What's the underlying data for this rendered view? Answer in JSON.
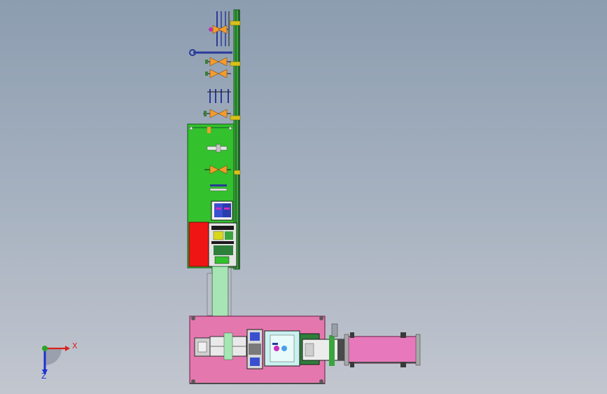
{
  "viewport": {
    "background_top": "#8c9db0",
    "background_bottom": "#c2c6cf"
  },
  "triad": {
    "x_label": "X",
    "y_label": "Y",
    "z_label": "Z",
    "x_color": "#d8221c",
    "y_color": "#2aa52c",
    "z_color": "#1e2fd0"
  },
  "model": {
    "components": [
      {
        "name": "upper-frame",
        "color": "#35a93a"
      },
      {
        "name": "main-green-plate",
        "color": "#33c12d"
      },
      {
        "name": "red-electrical-box",
        "color": "#f01515"
      },
      {
        "name": "light-green-conveyor",
        "color": "#a7e6b4"
      },
      {
        "name": "base-pink-plate",
        "color": "#e478ae"
      },
      {
        "name": "output-pink-conveyor",
        "color": "#e778bb"
      },
      {
        "name": "cyan-stage",
        "color": "#c9f1ef"
      },
      {
        "name": "dark-green-block",
        "color": "#2e7f3a"
      },
      {
        "name": "blue-module",
        "color": "#3a4fd0"
      }
    ]
  }
}
